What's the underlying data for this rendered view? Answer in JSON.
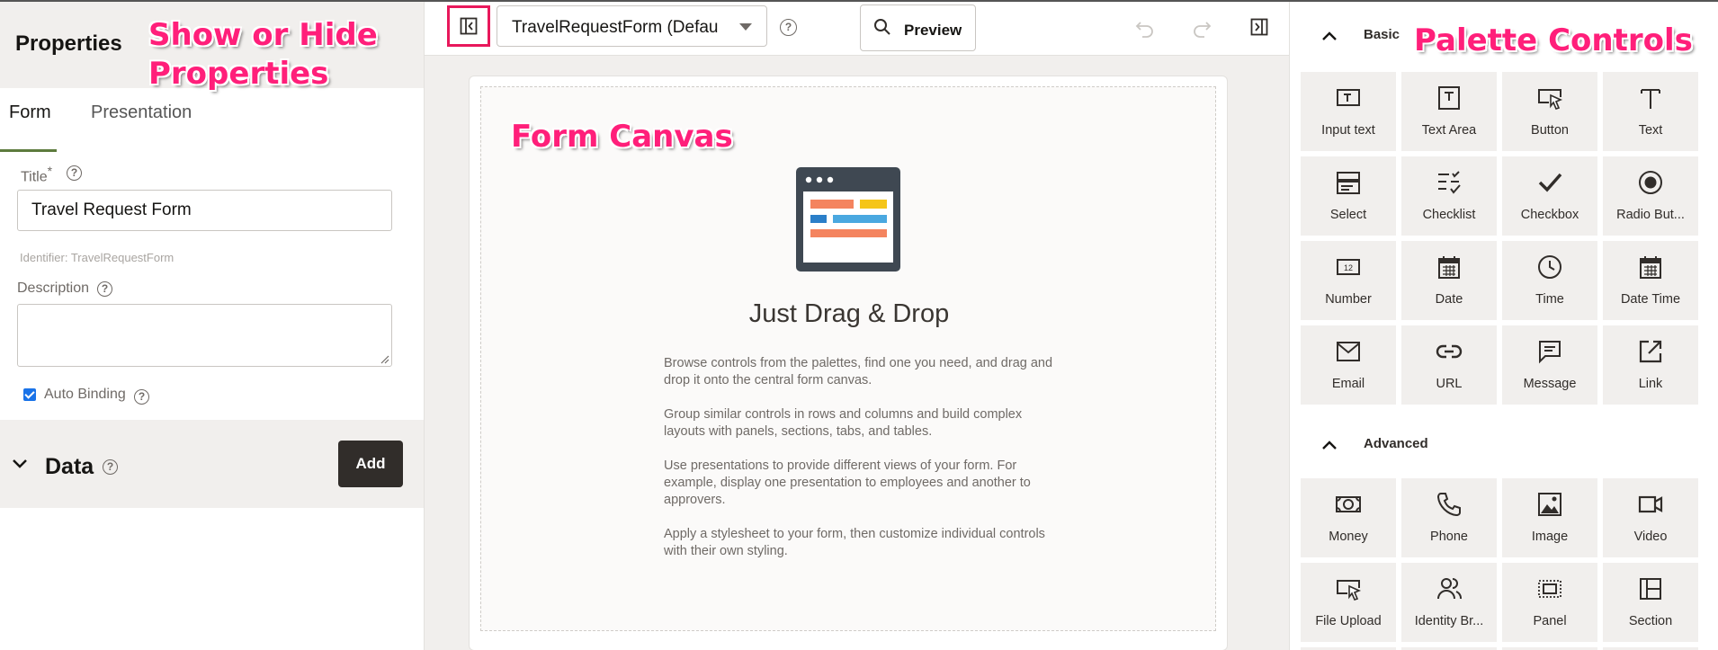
{
  "left_panel": {
    "title": "Properties",
    "tabs": [
      {
        "label": "Form"
      },
      {
        "label": "Presentation"
      }
    ],
    "title_field": {
      "label": "Title",
      "required_mark": "*",
      "value": "Travel Request Form"
    },
    "identifier": "Identifier: TravelRequestForm",
    "description_field": {
      "label": "Description",
      "value": ""
    },
    "auto_binding": {
      "label": "Auto Binding",
      "checked": true
    },
    "data_section": {
      "label": "Data",
      "add_label": "Add"
    }
  },
  "toolbar": {
    "toggle_icon": "panel-collapse-left-icon",
    "form_select": {
      "value": "TravelRequestForm (Defau"
    },
    "preview_label": "Preview",
    "undo_icon": "undo-icon",
    "redo_icon": "redo-icon",
    "right_toggle_icon": "panel-collapse-right-icon"
  },
  "canvas": {
    "heading": "Just Drag & Drop",
    "paragraphs": [
      "Browse controls from the palettes, find one you need, and drag and drop it onto the central form canvas.",
      "Group similar controls in rows and columns and build complex layouts with panels, sections, tabs, and tables.",
      "Use presentations to provide different views of your form. For example, display one presentation to employees and another to approvers.",
      "Apply a stylesheet to your form, then customize individual controls with their own styling."
    ]
  },
  "palette": {
    "basic": {
      "label": "Basic",
      "items": [
        {
          "label": "Input text",
          "icon": "input-text-icon"
        },
        {
          "label": "Text Area",
          "icon": "text-area-icon"
        },
        {
          "label": "Button",
          "icon": "button-icon"
        },
        {
          "label": "Text",
          "icon": "text-icon"
        },
        {
          "label": "Select",
          "icon": "select-icon"
        },
        {
          "label": "Checklist",
          "icon": "checklist-icon"
        },
        {
          "label": "Checkbox",
          "icon": "checkbox-icon"
        },
        {
          "label": "Radio But...",
          "icon": "radio-button-icon"
        },
        {
          "label": "Number",
          "icon": "number-icon"
        },
        {
          "label": "Date",
          "icon": "date-icon"
        },
        {
          "label": "Time",
          "icon": "time-icon"
        },
        {
          "label": "Date Time",
          "icon": "date-time-icon"
        },
        {
          "label": "Email",
          "icon": "email-icon"
        },
        {
          "label": "URL",
          "icon": "url-icon"
        },
        {
          "label": "Message",
          "icon": "message-icon"
        },
        {
          "label": "Link",
          "icon": "link-icon"
        }
      ]
    },
    "advanced": {
      "label": "Advanced",
      "items": [
        {
          "label": "Money",
          "icon": "money-icon"
        },
        {
          "label": "Phone",
          "icon": "phone-icon"
        },
        {
          "label": "Image",
          "icon": "image-icon"
        },
        {
          "label": "Video",
          "icon": "video-icon"
        },
        {
          "label": "File Upload",
          "icon": "file-upload-icon"
        },
        {
          "label": "Identity Br...",
          "icon": "identity-browser-icon"
        },
        {
          "label": "Panel",
          "icon": "panel-icon"
        },
        {
          "label": "Section",
          "icon": "section-icon"
        }
      ]
    }
  },
  "annotations": {
    "show_hide": [
      "Show or Hide",
      "Properties"
    ],
    "form_canvas": "Form Canvas",
    "palette_controls": "Palette Controls"
  },
  "colors": {
    "annotation": "#ff1f7a",
    "tab_underline": "#5d7b3d",
    "add_button": "#312d2a",
    "tile_bg": "#f1efed"
  }
}
